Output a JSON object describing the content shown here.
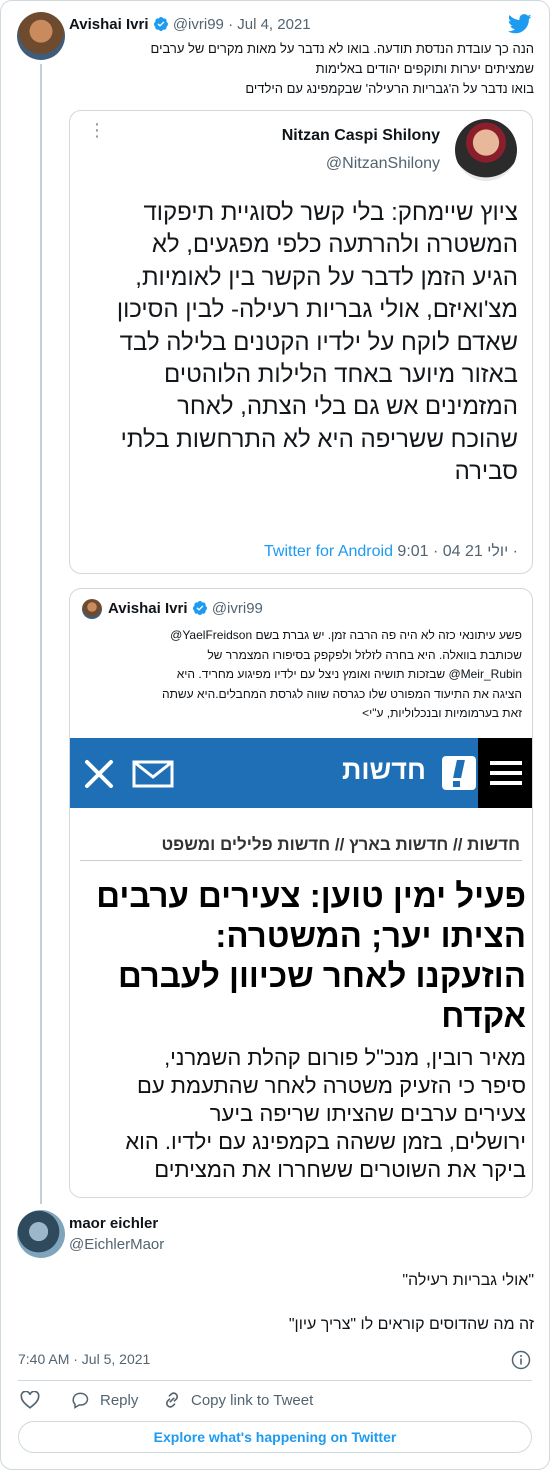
{
  "main_tweet": {
    "author_name": "Avishai Ivri",
    "handle": "@ivri99",
    "date": "Jul 4, 2021",
    "lines": [
      "הנה כך עובדת הנדסת תודעה. בואו לא נדבר על מאות מקרים של ערבים",
      "שמציתים יערות ותוקפים יהודים באלימות",
      "בואו נדבר על ה'גבריות הרעילה' שבקמפינג עם הילדים"
    ]
  },
  "embedded_tweet": {
    "author_name": "Nitzan Caspi Shilony",
    "handle": "@NitzanShilony",
    "lines": [
      "ציוץ שיימחק: בלי קשר לסוגיית תיפקוד",
      "המשטרה ולהרתעה כלפי מפגעים, לא",
      "הגיע הזמן לדבר על הקשר בין לאומיות,",
      "מצ'ואיזם, אולי גבריות רעילה- לבין הסיכון",
      "שאדם לוקח על ילדיו הקטנים בלילה לבד",
      "באזור מיוער באחד הלילות הלוהטים",
      "המזמינים אש גם בלי הצתה, לאחר",
      "שהוכח ששריפה היא לא התרחשות בלתי",
      "סבירה"
    ],
    "footer_time": "9:01 · 04 יולי 21 ·",
    "footer_source": "Twitter for Android"
  },
  "quoted_tweet": {
    "author_name": "Avishai Ivri",
    "handle": "@ivri99",
    "lines": [
      "פשע עיתונאי כזה לא היה פה הרבה זמן. יש גברת בשם YaelFreidson@",
      "שכותבת בוואלה. היא בחרה לזלזל ולפקפק בסיפורו המצמרר של",
      "Meir_Rubin@ שבזכות תושיה ואומץ ניצל עם ילדיו מפיגוע מחריד. היא",
      "הציגה את התיעוד המפורט שלו כגרסה שווה לגרסת המחבלים.היא עשתה",
      "זאת בערמומיות ובנכלוליות, ע\"י>"
    ]
  },
  "news_screenshot": {
    "site_name": "חדשות",
    "breadcrumb": "חדשות // חדשות בארץ // חדשות פלילים ומשפט",
    "headline_lines": [
      "פעיל ימין טוען: צעירים ערבים",
      "הציתו יער; המשטרה:",
      "הוזעקנו לאחר שכיוון לעברם",
      "אקדח"
    ],
    "body_lines": [
      "מאיר רובין, מנכ\"ל פורום קהלת השמרני,",
      "סיפר כי הזעיק משטרה לאחר שהתעמת עם",
      "צעירים ערבים שהציתו שריפה ביער",
      "ירושלים, בזמן ששהה בקמפינג עם ילדיו. הוא",
      "ביקר את השוטרים ששחררו את המציתים"
    ],
    "colors": {
      "header_bg": "#1e6fb5",
      "menu_bg": "#000000"
    }
  },
  "reply_tweet": {
    "author_name": "maor eichler",
    "handle": "@EichlerMaor",
    "line1": "\"אולי גבריות רעילה\"",
    "line2": "זה מה שהדוסים קוראים לו \"צריך עיון\"",
    "timestamp": "7:40 AM · Jul 5, 2021"
  },
  "actions": {
    "reply_label": "Reply",
    "copy_label": "Copy link to Tweet",
    "explore_label": "Explore what's happening on Twitter"
  },
  "colors": {
    "accent": "#1d9bf0",
    "muted": "#536471",
    "border": "#cfd9de"
  }
}
